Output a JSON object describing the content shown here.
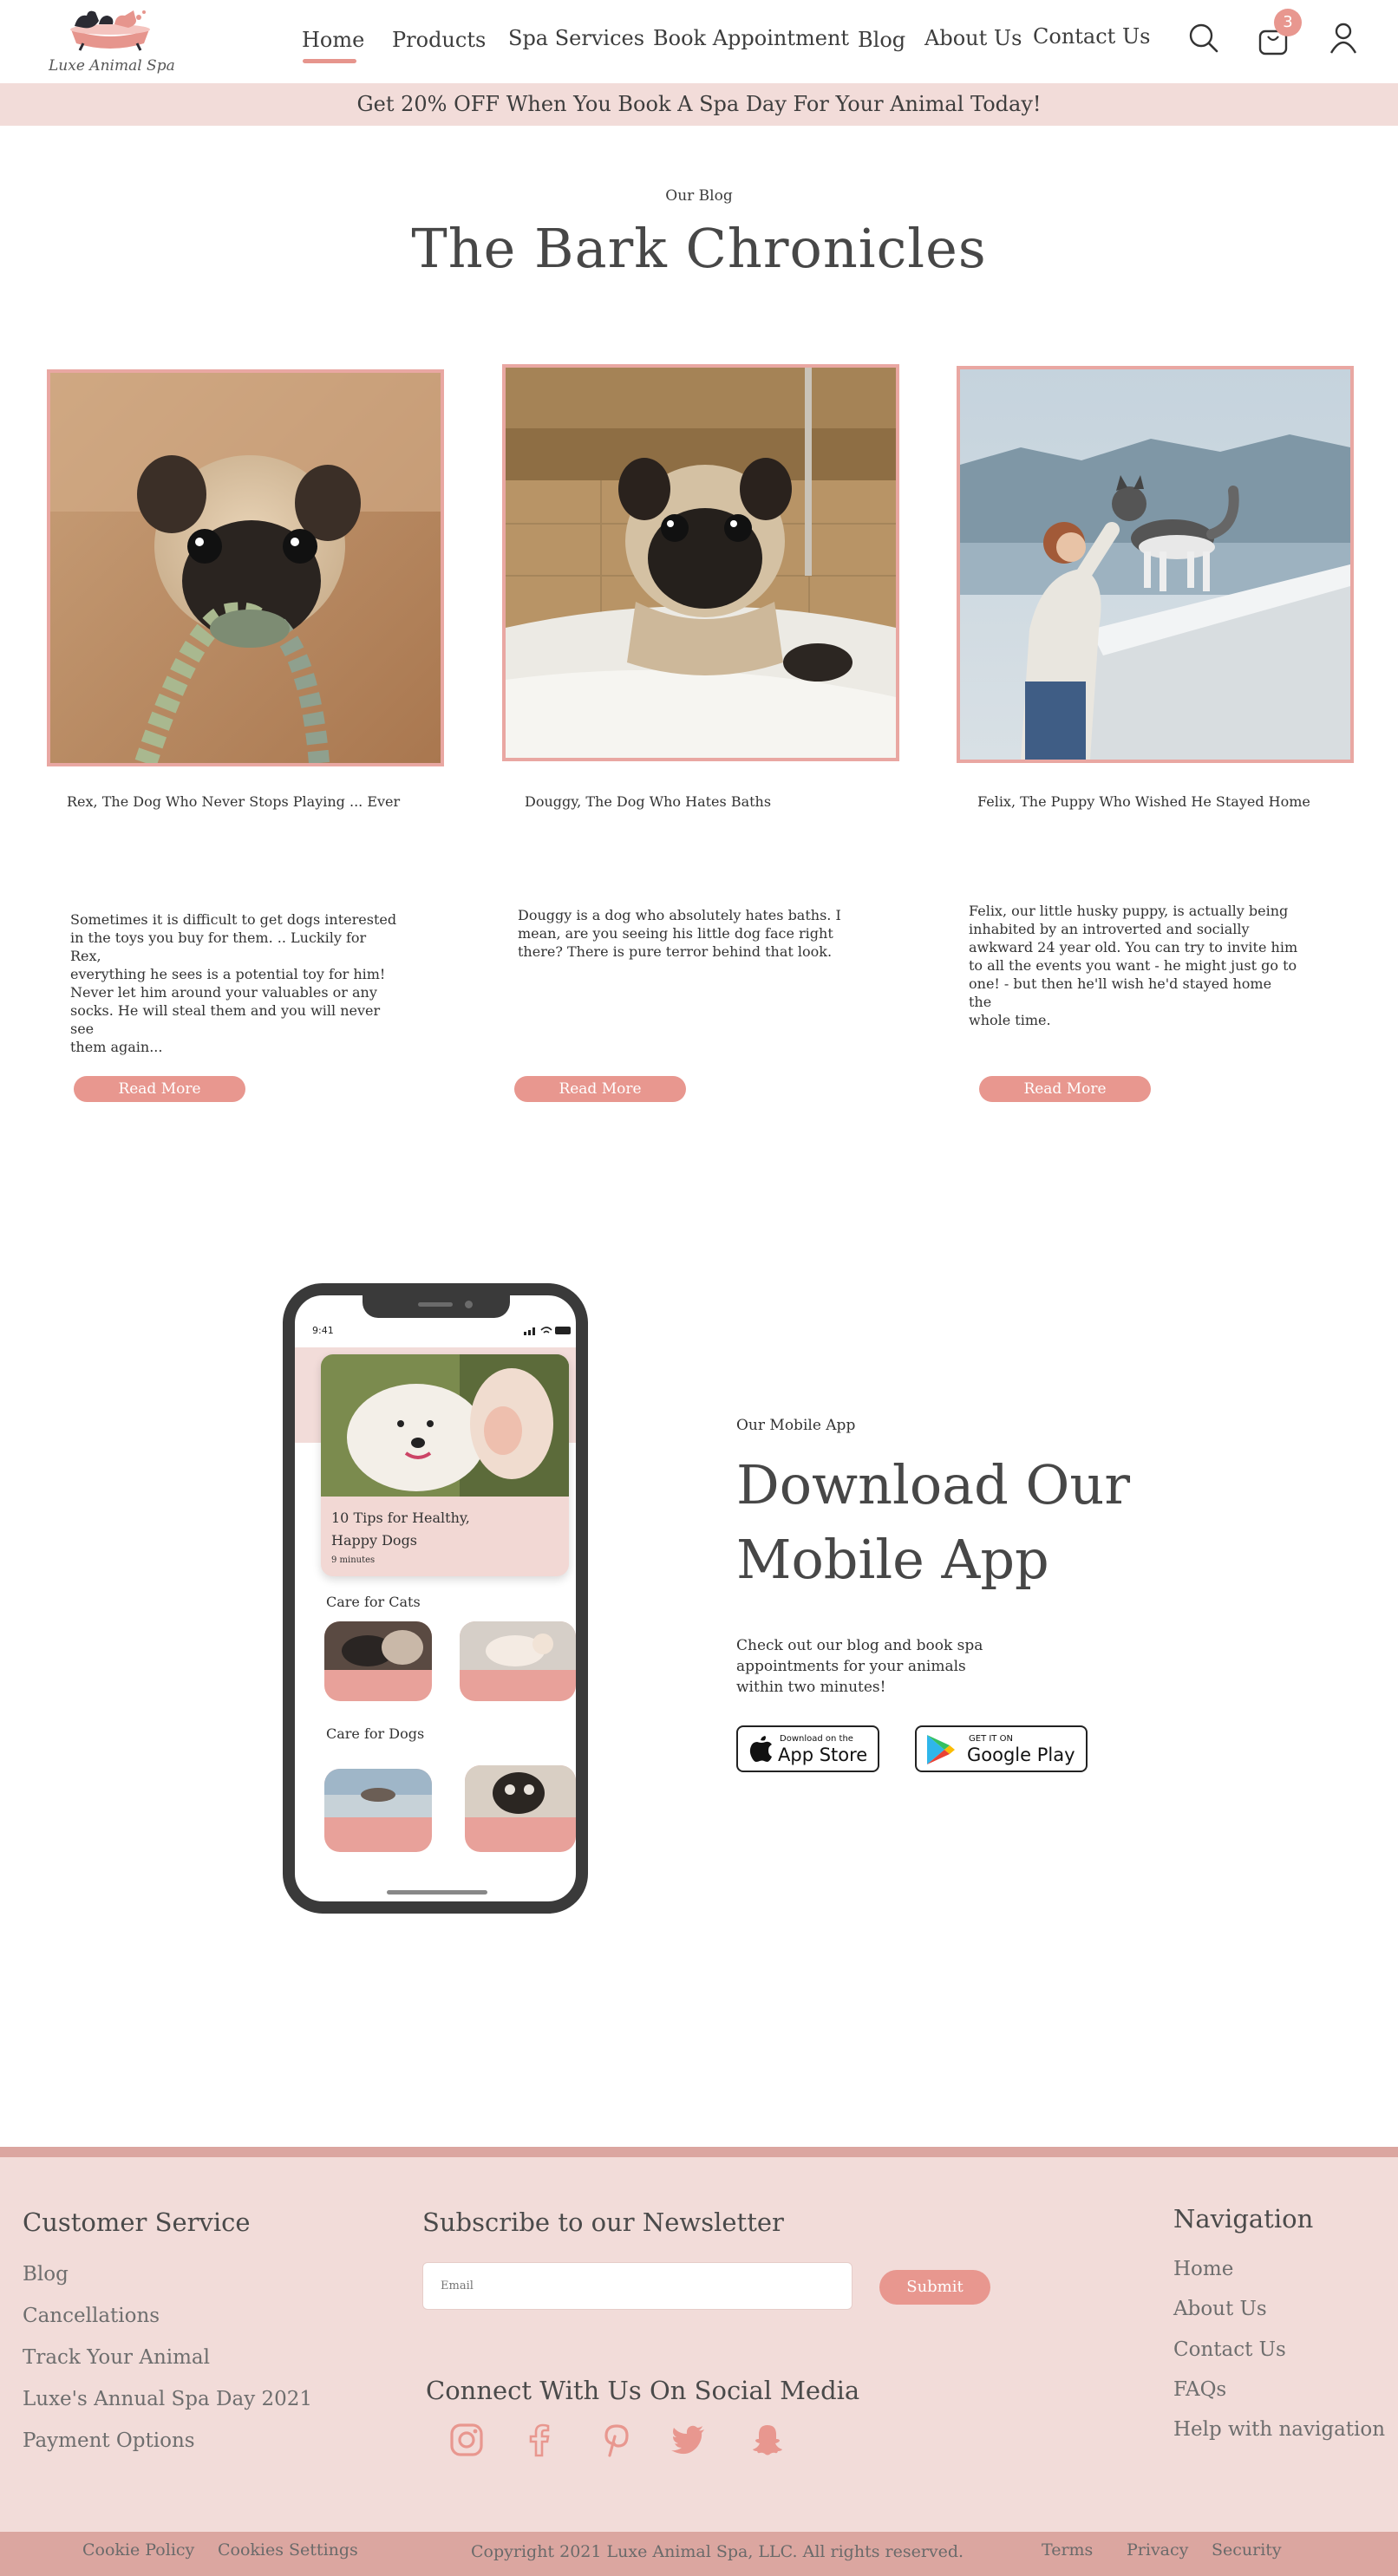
{
  "brand": {
    "name": "Luxe Animal Spa"
  },
  "nav": {
    "items": [
      "Home",
      "Products",
      "Spa Services",
      "Book Appointment",
      "Blog",
      "About Us",
      "Contact Us"
    ],
    "active": "Home",
    "cart_count": "3"
  },
  "promo": {
    "text": "Get 20% OFF When You Book A Spa Day For Your Animal Today!"
  },
  "blog": {
    "eyebrow": "Our Blog",
    "title": "The Bark Chronicles",
    "posts": [
      {
        "title": "Rex, The Dog Who Never Stops Playing ... Ever",
        "lines": [
          "Sometimes it is difficult to get dogs interested",
          "in the toys you buy for them. .. Luckily for Rex,",
          "everything he sees is a potential toy for him!",
          "Never let him around your valuables or any",
          "socks. He will steal them and you will never see",
          "them again..."
        ],
        "cta": "Read More"
      },
      {
        "title": "Douggy, The Dog Who Hates Baths",
        "lines": [
          "Douggy is a dog who absolutely hates baths. I",
          "mean, are you seeing his little dog face right",
          "there? There is pure terror behind that look."
        ],
        "cta": "Read More"
      },
      {
        "title": "Felix, The Puppy Who Wished He Stayed Home",
        "lines": [
          "Felix, our little husky puppy, is actually being",
          "inhabited by an introverted and socially",
          "awkward 24 year old. You can try to invite him",
          "to all the events you want - he might just go to",
          "one! - but then he'll wish he'd stayed home the",
          "whole time."
        ],
        "cta": "Read More"
      }
    ]
  },
  "phone": {
    "time": "9:41",
    "feature_title_line1": "10 Tips for Healthy,",
    "feature_title_line2": "Happy Dogs",
    "feature_meta": "9 minutes",
    "cats_heading": "Care for Cats",
    "dogs_heading": "Care for Dogs"
  },
  "app": {
    "eyebrow": "Our Mobile App",
    "title_line1": "Download Our",
    "title_line2": "Mobile App",
    "desc_line1": "Check out our blog and book spa",
    "desc_line2": "appointments for your animals",
    "desc_line3": "within two minutes!",
    "appstore_small": "Download on the",
    "appstore_big": "App Store",
    "play_small": "GET IT ON",
    "play_big": "Google Play"
  },
  "footer": {
    "customer_service": {
      "heading": "Customer Service",
      "links": [
        "Blog",
        "Cancellations",
        "Track Your Animal",
        "Luxe's Annual Spa Day 2021",
        "Payment Options"
      ]
    },
    "newsletter": {
      "heading": "Subscribe to our Newsletter",
      "placeholder": "Email",
      "submit": "Submit"
    },
    "social": {
      "heading": "Connect With Us On Social Media",
      "icons": [
        "instagram-icon",
        "facebook-icon",
        "pinterest-icon",
        "twitter-icon",
        "snapchat-icon"
      ]
    },
    "navigation": {
      "heading": "Navigation",
      "links": [
        "Home",
        "About Us",
        "Contact Us",
        "FAQs",
        "Help with navigation"
      ]
    }
  },
  "bottom": {
    "cookie_policy": "Cookie Policy",
    "cookie_settings": "Cookies Settings",
    "copyright": "Copyright 2021 Luxe Animal Spa, LLC. All rights reserved.",
    "terms": "Terms",
    "privacy": "Privacy",
    "security": "Security"
  },
  "colors": {
    "accent": "#e8978f",
    "blush": "#f2dcd9",
    "rose": "#dba6a0",
    "text": "#3d3d3d"
  }
}
